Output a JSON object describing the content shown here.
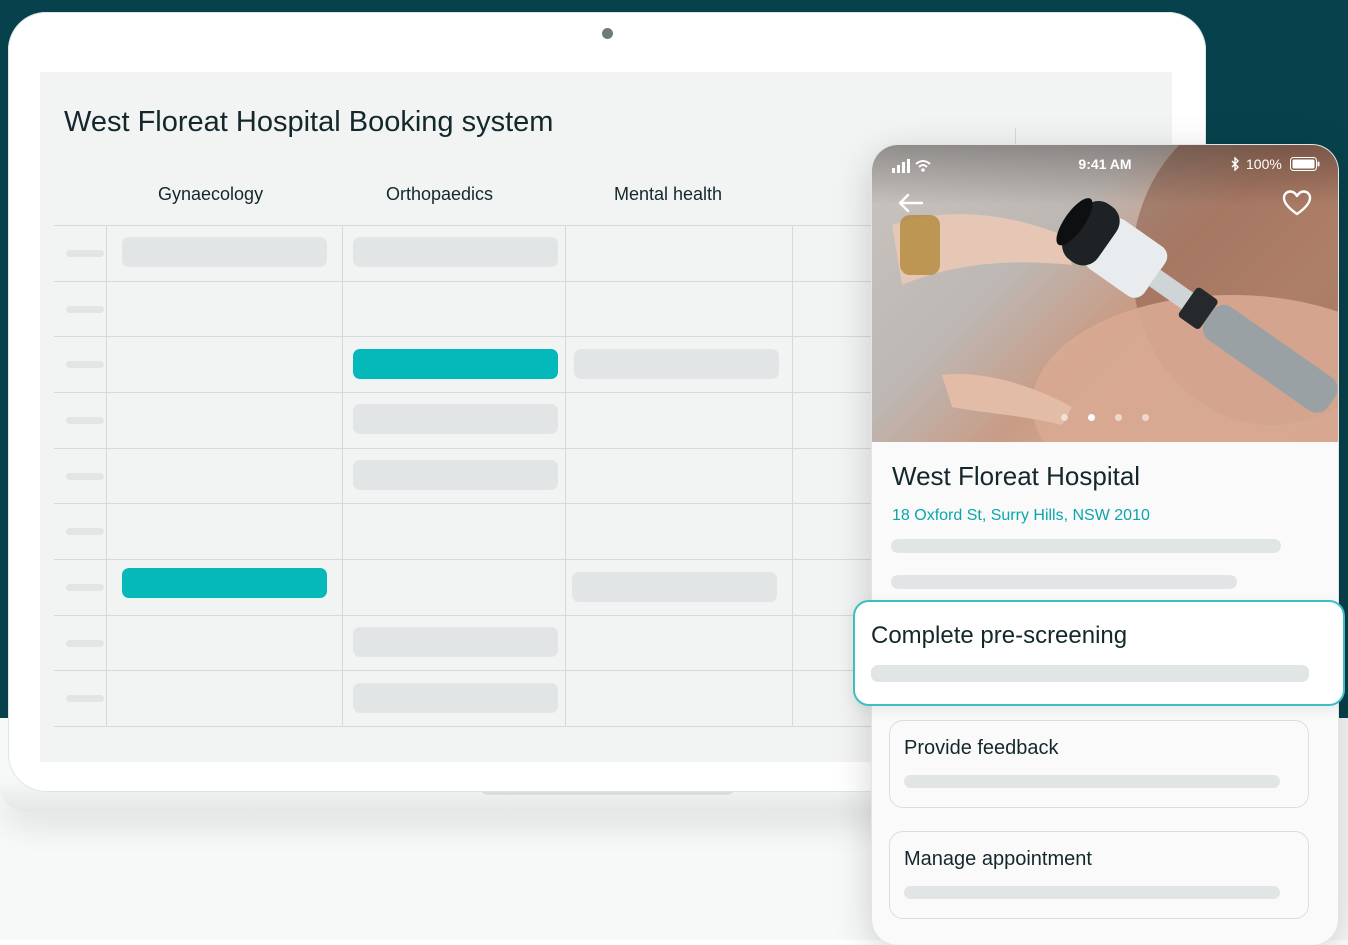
{
  "app": {
    "title": "West Floreat Hospital Booking system",
    "columns": [
      "Gynaecology",
      "Orthopaedics",
      "Mental health"
    ]
  },
  "phone": {
    "status": {
      "time": "9:41 AM",
      "battery": "100%"
    },
    "icons": {
      "back": "arrow-left-icon",
      "favorite": "heart-icon",
      "signal": "signal-icon",
      "wifi": "wifi-icon",
      "bluetooth": "bluetooth-icon",
      "battery": "battery-icon"
    },
    "carousel": {
      "count": 4,
      "current": 2
    },
    "hospital": {
      "name": "West Floreat Hospital",
      "address": "18 Oxford St, Surry Hills, NSW 2010"
    },
    "actions": [
      {
        "label": "Complete pre-screening"
      },
      {
        "label": "Provide feedback"
      },
      {
        "label": "Manage appointment"
      }
    ]
  },
  "colors": {
    "background": "#07424c",
    "accent": "#05b8ba",
    "address": "#0aa6ab",
    "skeleton": "#e2e5e6"
  }
}
